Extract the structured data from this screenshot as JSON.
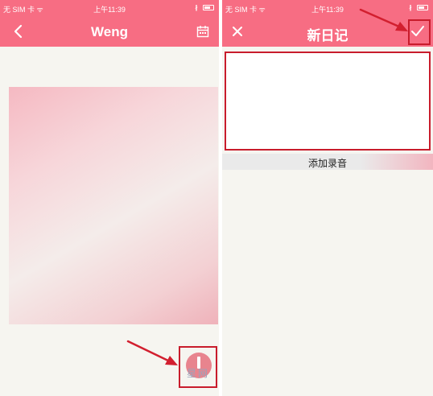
{
  "colors": {
    "accent": "#f76d83",
    "highlight": "#c81c2c",
    "background": "#f6f5f0"
  },
  "left_screen": {
    "status_bar": {
      "carrier": "无 SIM 卡 ᯤ",
      "time": "上午11:39",
      "bluetooth": "∦"
    },
    "nav": {
      "title": "Weng",
      "back_icon": "chevron-left-icon",
      "calendar_icon": "calendar-icon"
    },
    "fab_icon": "add-diary-button",
    "watermark": "星网"
  },
  "right_screen": {
    "status_bar": {
      "carrier": "无 SIM 卡 ᯤ",
      "time": "上午11:39",
      "bluetooth": "∦"
    },
    "nav": {
      "title": "新日记",
      "close_icon": "close-icon",
      "confirm_icon": "check-icon"
    },
    "add_recording_label": "添加录音"
  }
}
